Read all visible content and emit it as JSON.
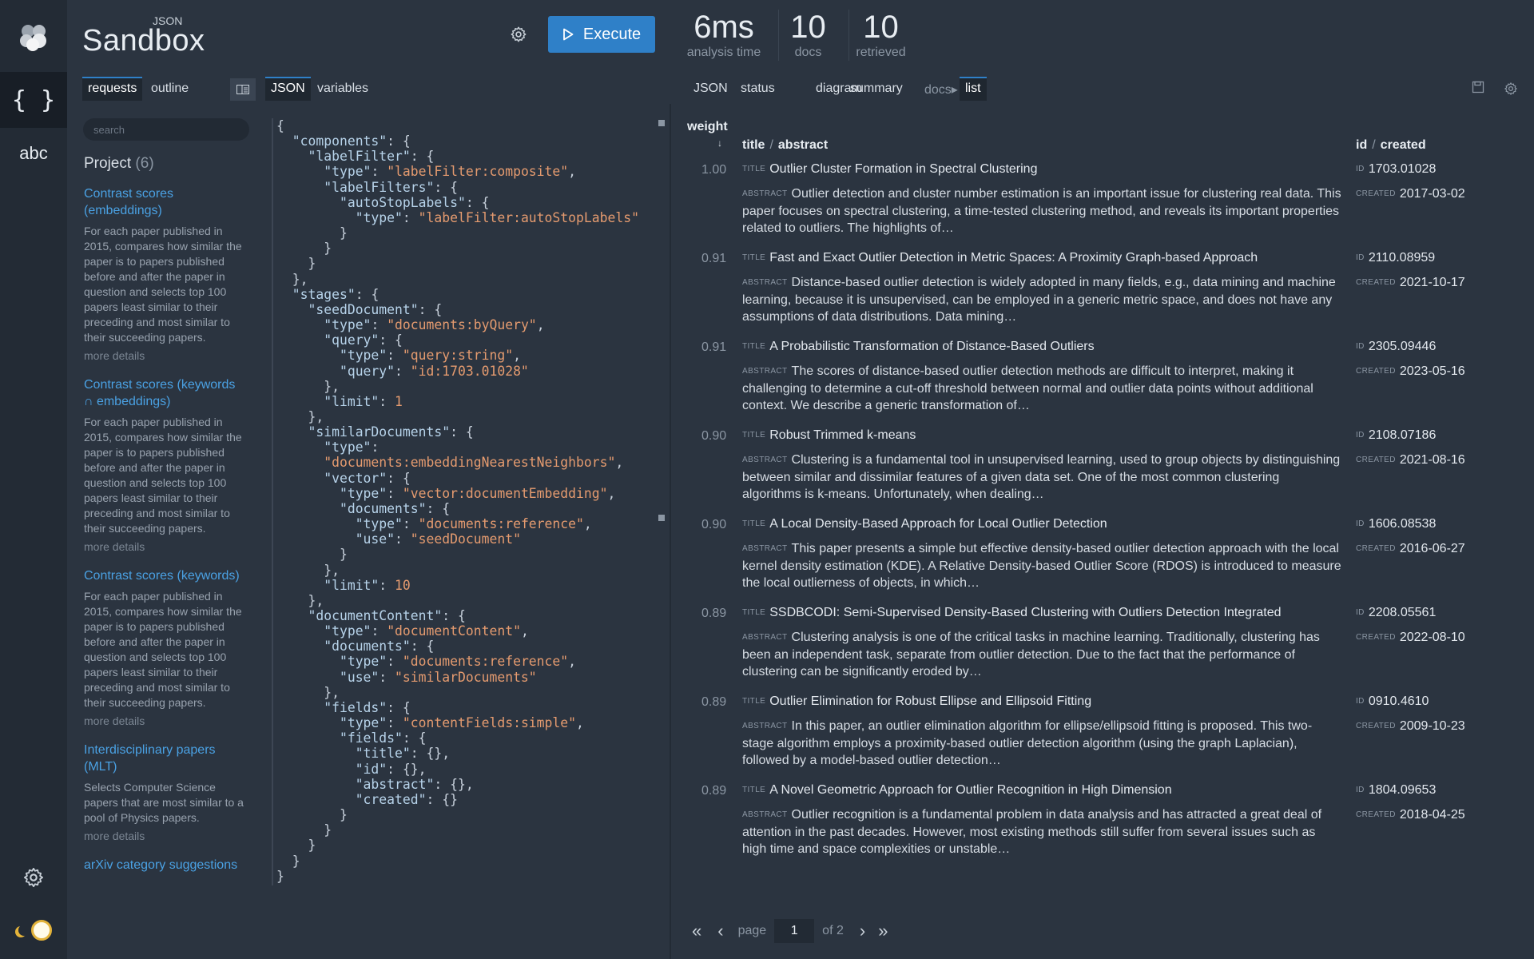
{
  "brand": {
    "super": "JSON",
    "name": "Sandbox"
  },
  "toolbar": {
    "execute_label": "Execute"
  },
  "stats": [
    {
      "value": "6ms",
      "label": "analysis time"
    },
    {
      "value": "10",
      "label": "docs"
    },
    {
      "value": "10",
      "label": "retrieved"
    }
  ],
  "rail": {
    "json_icon": "{ }",
    "abc": "abc"
  },
  "left_tabs": [
    "requests",
    "outline"
  ],
  "editor_tabs": [
    "JSON",
    "variables"
  ],
  "right_tabs": {
    "json": "JSON",
    "status": "status",
    "diagram": "diagram",
    "summary": "summary",
    "docs": "docs▸",
    "list": "list"
  },
  "sidebar": {
    "search_placeholder": "search",
    "project_label": "Project",
    "project_count": "(6)",
    "requests": [
      {
        "title": "Contrast scores (embeddings)",
        "desc": "For each paper published in 2015, compares how similar the paper is to papers published before and after the paper in question and selects top 100 papers least similar to their preceding and most similar to their succeeding papers.",
        "more": "more details"
      },
      {
        "title": "Contrast scores (keywords ∩ embeddings)",
        "desc": "For each paper published in 2015, compares how similar the paper is to papers published before and after the paper in question and selects top 100 papers least similar to their preceding and most similar to their succeeding papers.",
        "more": "more details"
      },
      {
        "title": "Contrast scores (keywords)",
        "desc": "For each paper published in 2015, compares how similar the paper is to papers published before and after the paper in question and selects top 100 papers least similar to their preceding and most similar to their succeeding papers.",
        "more": "more details"
      },
      {
        "title": "Interdisciplinary papers (MLT)",
        "desc": "Selects Computer Science papers that are most similar to a pool of Physics papers.",
        "more": "more details"
      },
      {
        "title": "arXiv category suggestions",
        "desc": "",
        "more": ""
      }
    ]
  },
  "results": {
    "col_weight": "weight",
    "col_weight_arrow": "↓",
    "col_title": "title",
    "col_abstract": "abstract",
    "col_id": "id",
    "col_created": "created",
    "label_title": "TITLE",
    "label_abstract": "ABSTRACT",
    "label_id": "ID",
    "label_created": "CREATED",
    "rows": [
      {
        "weight": "1.00",
        "title": "Outlier Cluster Formation in Spectral Clustering",
        "abstract": "Outlier detection and cluster number estimation is an important issue for clustering real data. This paper focuses on spectral clustering, a time-tested clustering method, and reveals its important properties related to outliers. The highlights of…",
        "id": "1703.01028",
        "created": "2017-03-02"
      },
      {
        "weight": "0.91",
        "title": "Fast and Exact Outlier Detection in Metric Spaces: A Proximity Graph-based Approach",
        "abstract": "Distance-based outlier detection is widely adopted in many fields, e.g., data mining and machine learning, because it is unsupervised, can be employed in a generic metric space, and does not have any assumptions of data distributions. Data mining…",
        "id": "2110.08959",
        "created": "2021-10-17"
      },
      {
        "weight": "0.91",
        "title": "A Probabilistic Transformation of Distance-Based Outliers",
        "abstract": "The scores of distance-based outlier detection methods are difficult to interpret, making it challenging to determine a cut-off threshold between normal and outlier data points without additional context. We describe a generic transformation of…",
        "id": "2305.09446",
        "created": "2023-05-16"
      },
      {
        "weight": "0.90",
        "title": "Robust Trimmed k-means",
        "abstract": "Clustering is a fundamental tool in unsupervised learning, used to group objects by distinguishing between similar and dissimilar features of a given data set. One of the most common clustering algorithms is k-means. Unfortunately, when dealing…",
        "id": "2108.07186",
        "created": "2021-08-16"
      },
      {
        "weight": "0.90",
        "title": "A Local Density-Based Approach for Local Outlier Detection",
        "abstract": "This paper presents a simple but effective density-based outlier detection approach with the local kernel density estimation (KDE). A Relative Density-based Outlier Score (RDOS) is introduced to measure the local outlierness of objects, in which…",
        "id": "1606.08538",
        "created": "2016-06-27"
      },
      {
        "weight": "0.89",
        "title": "SSDBCODI: Semi-Supervised Density-Based Clustering with Outliers Detection Integrated",
        "abstract": "Clustering analysis is one of the critical tasks in machine learning. Traditionally, clustering has been an independent task, separate from outlier detection. Due to the fact that the performance of clustering can be significantly eroded by…",
        "id": "2208.05561",
        "created": "2022-08-10"
      },
      {
        "weight": "0.89",
        "title": "Outlier Elimination for Robust Ellipse and Ellipsoid Fitting",
        "abstract": "In this paper, an outlier elimination algorithm for ellipse/ellipsoid fitting is proposed. This two-stage algorithm employs a proximity-based outlier detection algorithm (using the graph Laplacian), followed by a model-based outlier detection…",
        "id": "0910.4610",
        "created": "2009-10-23"
      },
      {
        "weight": "0.89",
        "title": "A Novel Geometric Approach for Outlier Recognition in High Dimension",
        "abstract": "Outlier recognition is a fundamental problem in data analysis and has attracted a great deal of attention in the past decades. However, most existing methods still suffer from several issues such as high time and space complexities or unstable…",
        "id": "1804.09653",
        "created": "2018-04-25"
      }
    ]
  },
  "pager": {
    "first": "«",
    "prev": "‹",
    "label": "page",
    "current": "1",
    "of": "of",
    "total": "2",
    "next": "›",
    "last": "»"
  },
  "editor_lines": [
    "{",
    "  \"components\": {",
    "    \"labelFilter\": {",
    "      \"type\": \"labelFilter:composite\",",
    "      \"labelFilters\": {",
    "        \"autoStopLabels\": {",
    "          \"type\": \"labelFilter:autoStopLabels\"",
    "        }",
    "      }",
    "    }",
    "  },",
    "  \"stages\": {",
    "    \"seedDocument\": {",
    "      \"type\": \"documents:byQuery\",",
    "      \"query\": {",
    "        \"type\": \"query:string\",",
    "        \"query\": \"id:1703.01028\"",
    "      },",
    "      \"limit\": 1",
    "    },",
    "    \"similarDocuments\": {",
    "      \"type\":",
    "      \"documents:embeddingNearestNeighbors\",",
    "      \"vector\": {",
    "        \"type\": \"vector:documentEmbedding\",",
    "        \"documents\": {",
    "          \"type\": \"documents:reference\",",
    "          \"use\": \"seedDocument\"",
    "        }",
    "      },",
    "      \"limit\": 10",
    "    },",
    "    \"documentContent\": {",
    "      \"type\": \"documentContent\",",
    "      \"documents\": {",
    "        \"type\": \"documents:reference\",",
    "        \"use\": \"similarDocuments\"",
    "      },",
    "      \"fields\": {",
    "        \"type\": \"contentFields:simple\",",
    "        \"fields\": {",
    "          \"title\": {},",
    "          \"id\": {},",
    "          \"abstract\": {},",
    "          \"created\": {}",
    "        }",
    "      }",
    "    }",
    "  }",
    "}"
  ]
}
